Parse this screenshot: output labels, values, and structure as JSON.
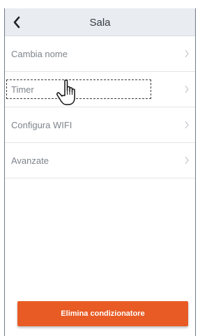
{
  "header": {
    "title": "Sala",
    "back_icon": "chevron-left-icon"
  },
  "menu": {
    "items": [
      {
        "label": "Cambia nome",
        "icon": "chevron-right-icon"
      },
      {
        "label": "Timer",
        "icon": "chevron-right-icon",
        "focused": true
      },
      {
        "label": "Configura WIFI",
        "icon": "chevron-right-icon"
      },
      {
        "label": "Avanzate",
        "icon": "chevron-right-icon"
      }
    ]
  },
  "footer": {
    "delete_label": "Elimina condizionatore"
  },
  "pointer": {
    "icon": "hand-pointer-icon"
  },
  "colors": {
    "header_bg": "#e9edf1",
    "accent": "#e85b24",
    "item_text": "#7d848b",
    "divider": "#e2e5e8"
  }
}
